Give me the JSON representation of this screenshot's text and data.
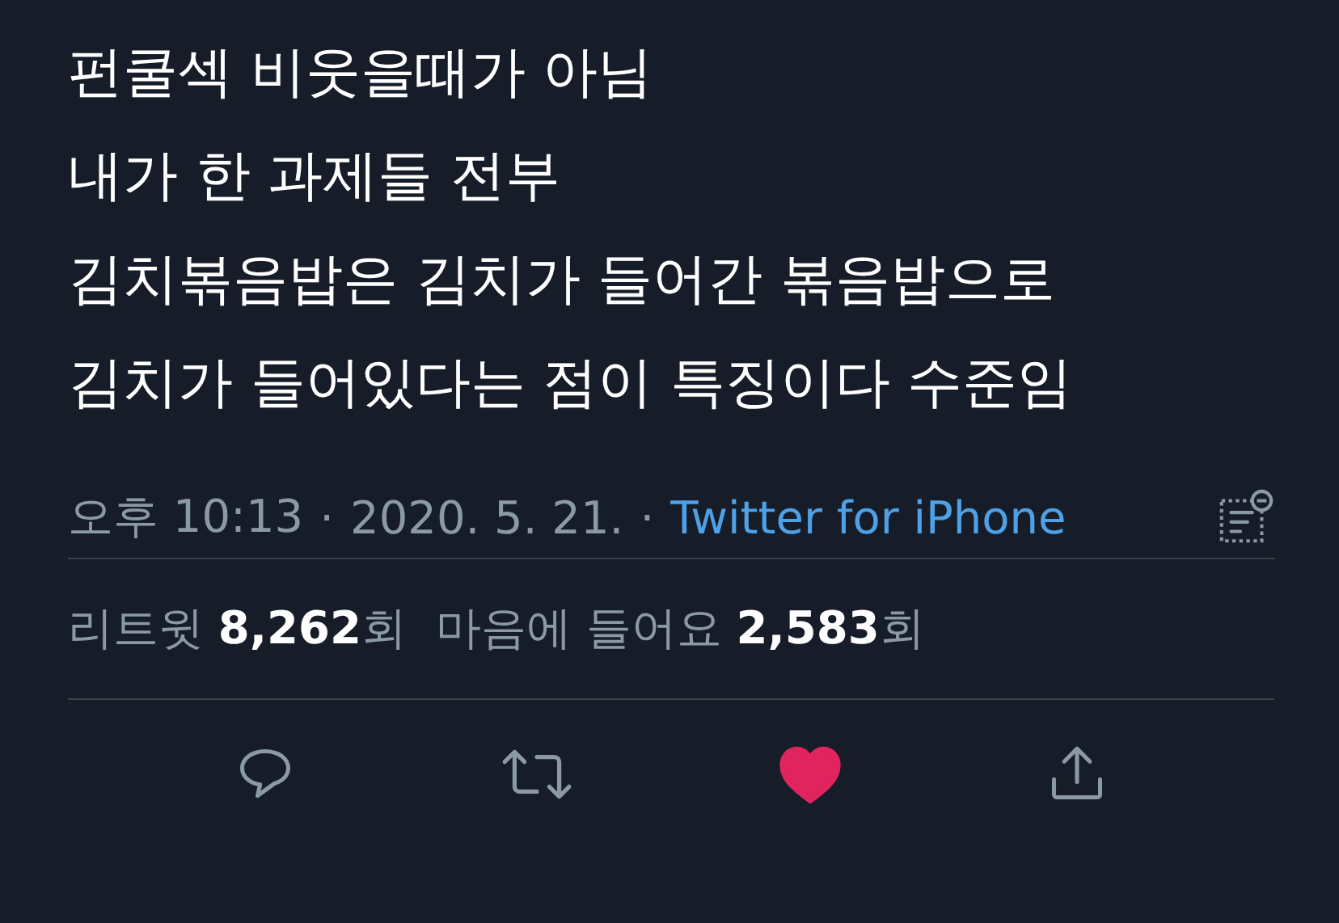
{
  "tweet": {
    "lines": [
      "펀쿨섹 비웃을때가 아님",
      "내가 한 과제들 전부",
      "김치볶음밥은 김치가 들어간 볶음밥으로",
      "김치가 들어있다는 점이 특징이다 수준임"
    ],
    "time": "오후 10:13",
    "separator_1": "·",
    "date": "2020. 5. 21.",
    "separator_2": "·",
    "source": "Twitter for iPhone"
  },
  "stats": [
    {
      "text": "리트윗 **8,262**회"
    },
    {
      "text": "마음에 들어요 **2,583**회"
    }
  ],
  "actions": [
    {
      "kind": "reply"
    },
    {
      "kind": "retweet"
    },
    {
      "kind": "like",
      "liked": true
    },
    {
      "kind": "share"
    }
  ]
}
